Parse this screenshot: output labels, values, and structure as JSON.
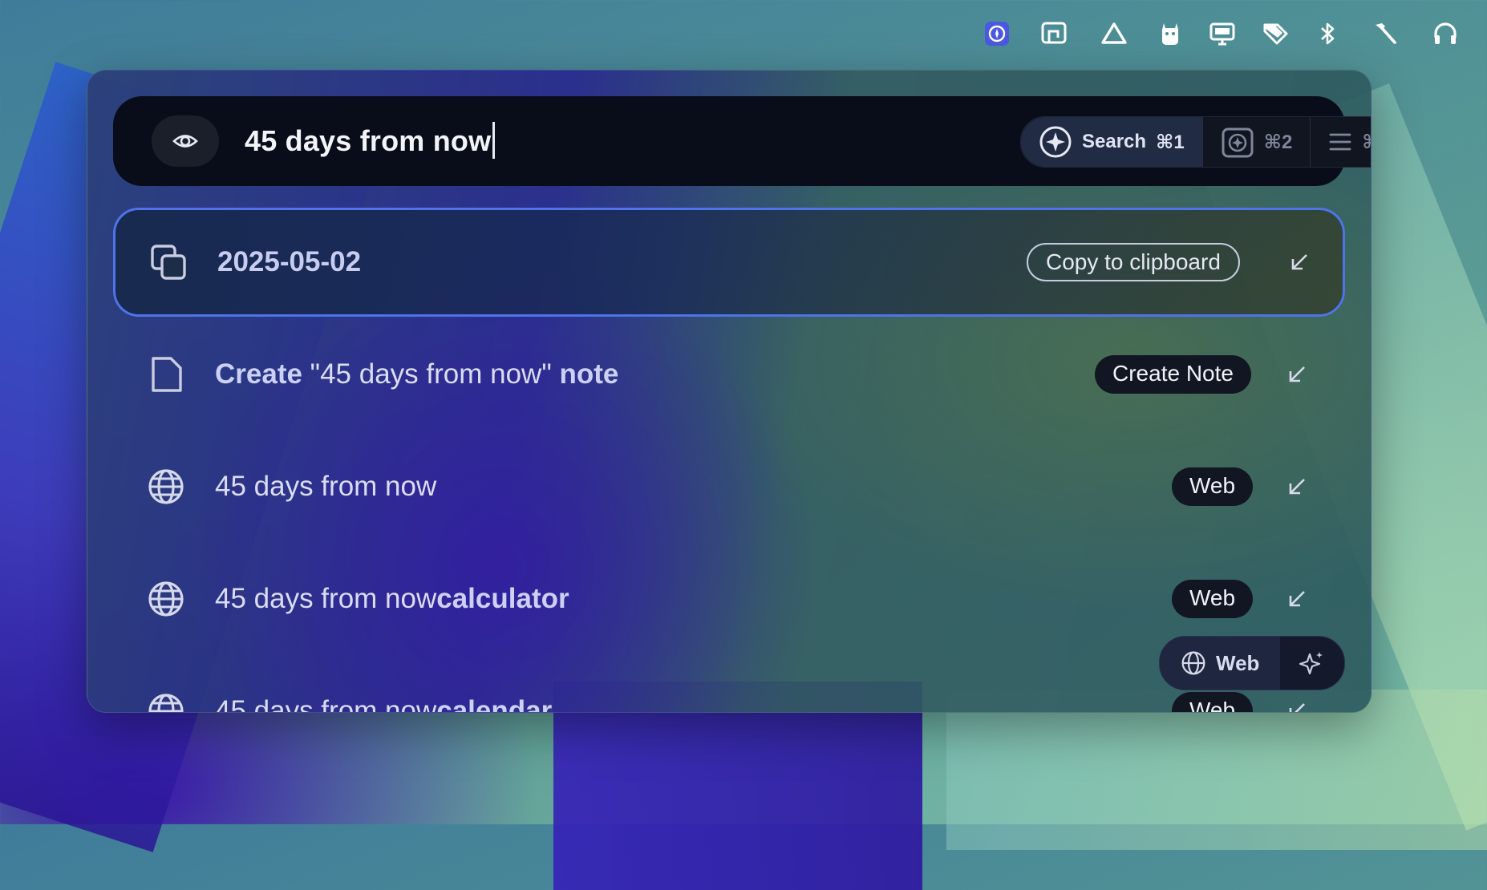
{
  "colors": {
    "accent": "#4f73e8",
    "searchbar_bg": "#090d19",
    "badge_bg": "#111622"
  },
  "menubar": {
    "icons": [
      "launcher-icon",
      "presenter-icon",
      "triangle-icon",
      "alpaca-icon",
      "display-icon",
      "tag-icon",
      "bluetooth-icon",
      "hammer-icon",
      "headphones-icon"
    ]
  },
  "search": {
    "query": "45 days from now",
    "modes": [
      {
        "label": "Search",
        "shortcut": "⌘1",
        "icon": "sparkle-compass-icon"
      },
      {
        "label": "",
        "shortcut": "⌘2",
        "icon": "screenshot-ai-icon"
      },
      {
        "label": "",
        "shortcut": "⌘K",
        "icon": "menu-icon"
      }
    ]
  },
  "results": [
    {
      "icon": "copy-icon",
      "title": "2025-05-02",
      "action": "Copy to clipboard",
      "selected": true
    },
    {
      "icon": "note-icon",
      "title_prefix": "Create ",
      "title_query": "\"45 days from now\"",
      "title_suffix": " note",
      "action": "Create Note"
    },
    {
      "icon": "globe-icon",
      "title": "45 days from now",
      "action": "Web"
    },
    {
      "icon": "globe-icon",
      "title_plain": "45 days from now",
      "title_bold": "calculator",
      "action": "Web"
    },
    {
      "icon": "globe-icon",
      "title_plain": "45 days from now",
      "title_bold": "calendar",
      "action": "Web"
    }
  ],
  "floating": {
    "web_label": "Web"
  }
}
